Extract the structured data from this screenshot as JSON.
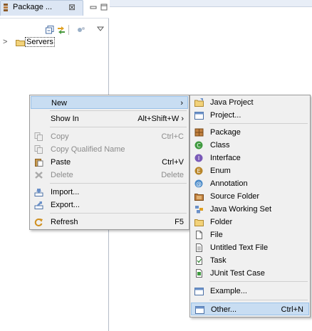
{
  "view": {
    "tab_title": "Package ...",
    "tab_close": "⊠",
    "tree_expand": ">",
    "tree_item": "Servers",
    "icons": [
      "package-explorer-icon",
      "collapse-all-icon",
      "link-with-editor-icon",
      "focus-icon",
      "view-menu-icon",
      "minimize-icon",
      "maximize-icon",
      "folder-icon"
    ]
  },
  "context_menu": {
    "items": [
      {
        "label": "New",
        "shortcut": "›",
        "enabled": true,
        "highlighted": true,
        "icon": ""
      },
      {
        "label": "Show In",
        "shortcut": "Alt+Shift+W ›",
        "enabled": true,
        "icon": ""
      },
      {
        "label": "Copy",
        "shortcut": "Ctrl+C",
        "enabled": false,
        "icon": "copy-icon"
      },
      {
        "label": "Copy Qualified Name",
        "shortcut": "",
        "enabled": false,
        "icon": "copy-qualified-name-icon"
      },
      {
        "label": "Paste",
        "shortcut": "Ctrl+V",
        "enabled": true,
        "icon": "paste-icon"
      },
      {
        "label": "Delete",
        "shortcut": "Delete",
        "enabled": false,
        "icon": "delete-icon"
      },
      {
        "label": "Import...",
        "shortcut": "",
        "enabled": true,
        "icon": "import-icon"
      },
      {
        "label": "Export...",
        "shortcut": "",
        "enabled": true,
        "icon": "export-icon"
      },
      {
        "label": "Refresh",
        "shortcut": "F5",
        "enabled": true,
        "icon": "refresh-icon"
      }
    ]
  },
  "submenu_new": {
    "items": [
      {
        "label": "Java Project",
        "shortcut": "",
        "icon": "java-project-icon"
      },
      {
        "label": "Project...",
        "shortcut": "",
        "icon": "project-icon"
      },
      {
        "label": "Package",
        "shortcut": "",
        "icon": "package-icon"
      },
      {
        "label": "Class",
        "shortcut": "",
        "icon": "class-icon"
      },
      {
        "label": "Interface",
        "shortcut": "",
        "icon": "interface-icon"
      },
      {
        "label": "Enum",
        "shortcut": "",
        "icon": "enum-icon"
      },
      {
        "label": "Annotation",
        "shortcut": "",
        "icon": "annotation-icon"
      },
      {
        "label": "Source Folder",
        "shortcut": "",
        "icon": "source-folder-icon"
      },
      {
        "label": "Java Working Set",
        "shortcut": "",
        "icon": "java-working-set-icon"
      },
      {
        "label": "Folder",
        "shortcut": "",
        "icon": "folder-icon"
      },
      {
        "label": "File",
        "shortcut": "",
        "icon": "file-icon"
      },
      {
        "label": "Untitled Text File",
        "shortcut": "",
        "icon": "untitled-text-file-icon"
      },
      {
        "label": "Task",
        "shortcut": "",
        "icon": "task-icon"
      },
      {
        "label": "JUnit Test Case",
        "shortcut": "",
        "icon": "junit-test-case-icon"
      },
      {
        "label": "Example...",
        "shortcut": "",
        "icon": "example-icon"
      },
      {
        "label": "Other...",
        "shortcut": "Ctrl+N",
        "icon": "other-icon",
        "highlighted": true
      }
    ]
  },
  "colors": {
    "highlight": "#c8ddf2",
    "menu_bg": "#f0f0f0",
    "disabled_text": "#8c8c8c"
  }
}
